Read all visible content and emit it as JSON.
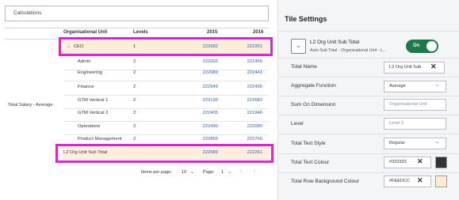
{
  "calculations_label": "Calculations",
  "table": {
    "headers": {
      "unit": "Organisational Unit",
      "levels": "Levels",
      "y2015": "2015",
      "y2016": "2016"
    },
    "pivot_label": "Total Salary - Average",
    "rows": [
      {
        "name": "CEO",
        "level": "1",
        "y2015": "222682",
        "y2016": "222261"
      },
      {
        "name": "Admin",
        "level": "2",
        "y2015": "222002",
        "y2016": "221456"
      },
      {
        "name": "Engineering",
        "level": "2",
        "y2015": "222989",
        "y2016": "222443"
      },
      {
        "name": "Finance",
        "level": "2",
        "y2015": "222949",
        "y2016": "222496"
      },
      {
        "name": "GTM Vertical 1",
        "level": "2",
        "y2015": "223130",
        "y2016": "222682"
      },
      {
        "name": "GTM Vertical 2",
        "level": "2",
        "y2015": "222405",
        "y2016": "221946"
      },
      {
        "name": "Operations",
        "level": "2",
        "y2015": "222490",
        "y2016": "222080"
      },
      {
        "name": "Product Management",
        "level": "2",
        "y2015": "222855",
        "y2016": "222766"
      }
    ],
    "subtotal": {
      "name": "L2 Org Unit Sub Total",
      "y2015": "222689",
      "y2016": "222261"
    }
  },
  "pager": {
    "items_label": "Items per page:",
    "items_value": "10",
    "page_label": "Page:",
    "page_value": "1"
  },
  "panel": {
    "title": "Tile Settings",
    "section": {
      "title": "L2 Org Unit Sub Total",
      "subtitle": "Auto Sub Total - Organisational Unit - L...",
      "toggle_label": "On"
    },
    "props": {
      "total_name": {
        "label": "Total Name",
        "value": "L2 Org Unit Sub"
      },
      "aggregate": {
        "label": "Aggregate Function",
        "value": "Average"
      },
      "sum_on": {
        "label": "Sum On Dimension",
        "value": "Organisational Unit"
      },
      "level": {
        "label": "Level",
        "value": "Level 2"
      },
      "text_style": {
        "label": "Total Text Style",
        "value": "Regular"
      },
      "text_colour": {
        "label": "Total Text Colour",
        "value": "#333333"
      },
      "row_bg": {
        "label": "Total Row Background Colour",
        "value": "#FEEDCC"
      }
    }
  },
  "colors": {
    "highlight": "#e61ed6",
    "toggle": "#1d7a4a",
    "subtotal_bg": "#fdeeda",
    "link_blue": "#2a5db0",
    "text_swatch": "#333333",
    "bg_swatch": "#FEEDCC"
  },
  "icons": {
    "collapse": "chevron-down-icon",
    "clear": "close-icon",
    "dropdown": "chevron-down-icon"
  }
}
